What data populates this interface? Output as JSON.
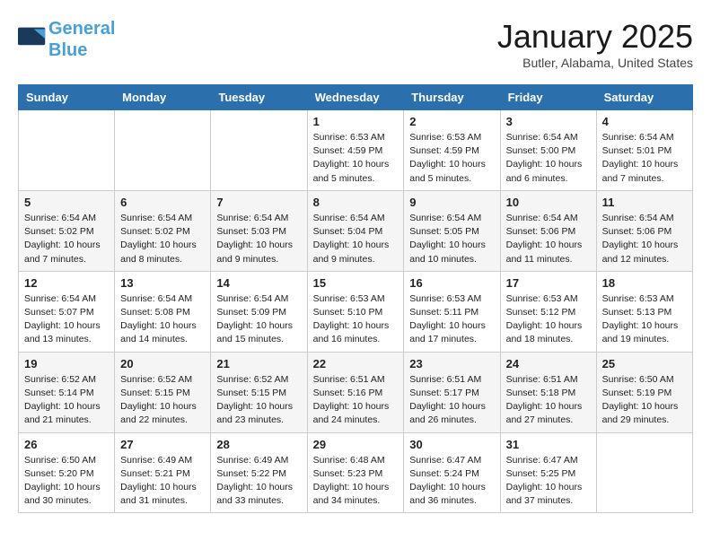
{
  "header": {
    "logo_line1": "General",
    "logo_line2": "Blue",
    "month": "January 2025",
    "location": "Butler, Alabama, United States"
  },
  "days_of_week": [
    "Sunday",
    "Monday",
    "Tuesday",
    "Wednesday",
    "Thursday",
    "Friday",
    "Saturday"
  ],
  "weeks": [
    [
      {
        "num": "",
        "sunrise": "",
        "sunset": "",
        "daylight": ""
      },
      {
        "num": "",
        "sunrise": "",
        "sunset": "",
        "daylight": ""
      },
      {
        "num": "",
        "sunrise": "",
        "sunset": "",
        "daylight": ""
      },
      {
        "num": "1",
        "sunrise": "Sunrise: 6:53 AM",
        "sunset": "Sunset: 4:59 PM",
        "daylight": "Daylight: 10 hours and 5 minutes."
      },
      {
        "num": "2",
        "sunrise": "Sunrise: 6:53 AM",
        "sunset": "Sunset: 4:59 PM",
        "daylight": "Daylight: 10 hours and 5 minutes."
      },
      {
        "num": "3",
        "sunrise": "Sunrise: 6:54 AM",
        "sunset": "Sunset: 5:00 PM",
        "daylight": "Daylight: 10 hours and 6 minutes."
      },
      {
        "num": "4",
        "sunrise": "Sunrise: 6:54 AM",
        "sunset": "Sunset: 5:01 PM",
        "daylight": "Daylight: 10 hours and 7 minutes."
      }
    ],
    [
      {
        "num": "5",
        "sunrise": "Sunrise: 6:54 AM",
        "sunset": "Sunset: 5:02 PM",
        "daylight": "Daylight: 10 hours and 7 minutes."
      },
      {
        "num": "6",
        "sunrise": "Sunrise: 6:54 AM",
        "sunset": "Sunset: 5:02 PM",
        "daylight": "Daylight: 10 hours and 8 minutes."
      },
      {
        "num": "7",
        "sunrise": "Sunrise: 6:54 AM",
        "sunset": "Sunset: 5:03 PM",
        "daylight": "Daylight: 10 hours and 9 minutes."
      },
      {
        "num": "8",
        "sunrise": "Sunrise: 6:54 AM",
        "sunset": "Sunset: 5:04 PM",
        "daylight": "Daylight: 10 hours and 9 minutes."
      },
      {
        "num": "9",
        "sunrise": "Sunrise: 6:54 AM",
        "sunset": "Sunset: 5:05 PM",
        "daylight": "Daylight: 10 hours and 10 minutes."
      },
      {
        "num": "10",
        "sunrise": "Sunrise: 6:54 AM",
        "sunset": "Sunset: 5:06 PM",
        "daylight": "Daylight: 10 hours and 11 minutes."
      },
      {
        "num": "11",
        "sunrise": "Sunrise: 6:54 AM",
        "sunset": "Sunset: 5:06 PM",
        "daylight": "Daylight: 10 hours and 12 minutes."
      }
    ],
    [
      {
        "num": "12",
        "sunrise": "Sunrise: 6:54 AM",
        "sunset": "Sunset: 5:07 PM",
        "daylight": "Daylight: 10 hours and 13 minutes."
      },
      {
        "num": "13",
        "sunrise": "Sunrise: 6:54 AM",
        "sunset": "Sunset: 5:08 PM",
        "daylight": "Daylight: 10 hours and 14 minutes."
      },
      {
        "num": "14",
        "sunrise": "Sunrise: 6:54 AM",
        "sunset": "Sunset: 5:09 PM",
        "daylight": "Daylight: 10 hours and 15 minutes."
      },
      {
        "num": "15",
        "sunrise": "Sunrise: 6:53 AM",
        "sunset": "Sunset: 5:10 PM",
        "daylight": "Daylight: 10 hours and 16 minutes."
      },
      {
        "num": "16",
        "sunrise": "Sunrise: 6:53 AM",
        "sunset": "Sunset: 5:11 PM",
        "daylight": "Daylight: 10 hours and 17 minutes."
      },
      {
        "num": "17",
        "sunrise": "Sunrise: 6:53 AM",
        "sunset": "Sunset: 5:12 PM",
        "daylight": "Daylight: 10 hours and 18 minutes."
      },
      {
        "num": "18",
        "sunrise": "Sunrise: 6:53 AM",
        "sunset": "Sunset: 5:13 PM",
        "daylight": "Daylight: 10 hours and 19 minutes."
      }
    ],
    [
      {
        "num": "19",
        "sunrise": "Sunrise: 6:52 AM",
        "sunset": "Sunset: 5:14 PM",
        "daylight": "Daylight: 10 hours and 21 minutes."
      },
      {
        "num": "20",
        "sunrise": "Sunrise: 6:52 AM",
        "sunset": "Sunset: 5:15 PM",
        "daylight": "Daylight: 10 hours and 22 minutes."
      },
      {
        "num": "21",
        "sunrise": "Sunrise: 6:52 AM",
        "sunset": "Sunset: 5:15 PM",
        "daylight": "Daylight: 10 hours and 23 minutes."
      },
      {
        "num": "22",
        "sunrise": "Sunrise: 6:51 AM",
        "sunset": "Sunset: 5:16 PM",
        "daylight": "Daylight: 10 hours and 24 minutes."
      },
      {
        "num": "23",
        "sunrise": "Sunrise: 6:51 AM",
        "sunset": "Sunset: 5:17 PM",
        "daylight": "Daylight: 10 hours and 26 minutes."
      },
      {
        "num": "24",
        "sunrise": "Sunrise: 6:51 AM",
        "sunset": "Sunset: 5:18 PM",
        "daylight": "Daylight: 10 hours and 27 minutes."
      },
      {
        "num": "25",
        "sunrise": "Sunrise: 6:50 AM",
        "sunset": "Sunset: 5:19 PM",
        "daylight": "Daylight: 10 hours and 29 minutes."
      }
    ],
    [
      {
        "num": "26",
        "sunrise": "Sunrise: 6:50 AM",
        "sunset": "Sunset: 5:20 PM",
        "daylight": "Daylight: 10 hours and 30 minutes."
      },
      {
        "num": "27",
        "sunrise": "Sunrise: 6:49 AM",
        "sunset": "Sunset: 5:21 PM",
        "daylight": "Daylight: 10 hours and 31 minutes."
      },
      {
        "num": "28",
        "sunrise": "Sunrise: 6:49 AM",
        "sunset": "Sunset: 5:22 PM",
        "daylight": "Daylight: 10 hours and 33 minutes."
      },
      {
        "num": "29",
        "sunrise": "Sunrise: 6:48 AM",
        "sunset": "Sunset: 5:23 PM",
        "daylight": "Daylight: 10 hours and 34 minutes."
      },
      {
        "num": "30",
        "sunrise": "Sunrise: 6:47 AM",
        "sunset": "Sunset: 5:24 PM",
        "daylight": "Daylight: 10 hours and 36 minutes."
      },
      {
        "num": "31",
        "sunrise": "Sunrise: 6:47 AM",
        "sunset": "Sunset: 5:25 PM",
        "daylight": "Daylight: 10 hours and 37 minutes."
      },
      {
        "num": "",
        "sunrise": "",
        "sunset": "",
        "daylight": ""
      }
    ]
  ]
}
